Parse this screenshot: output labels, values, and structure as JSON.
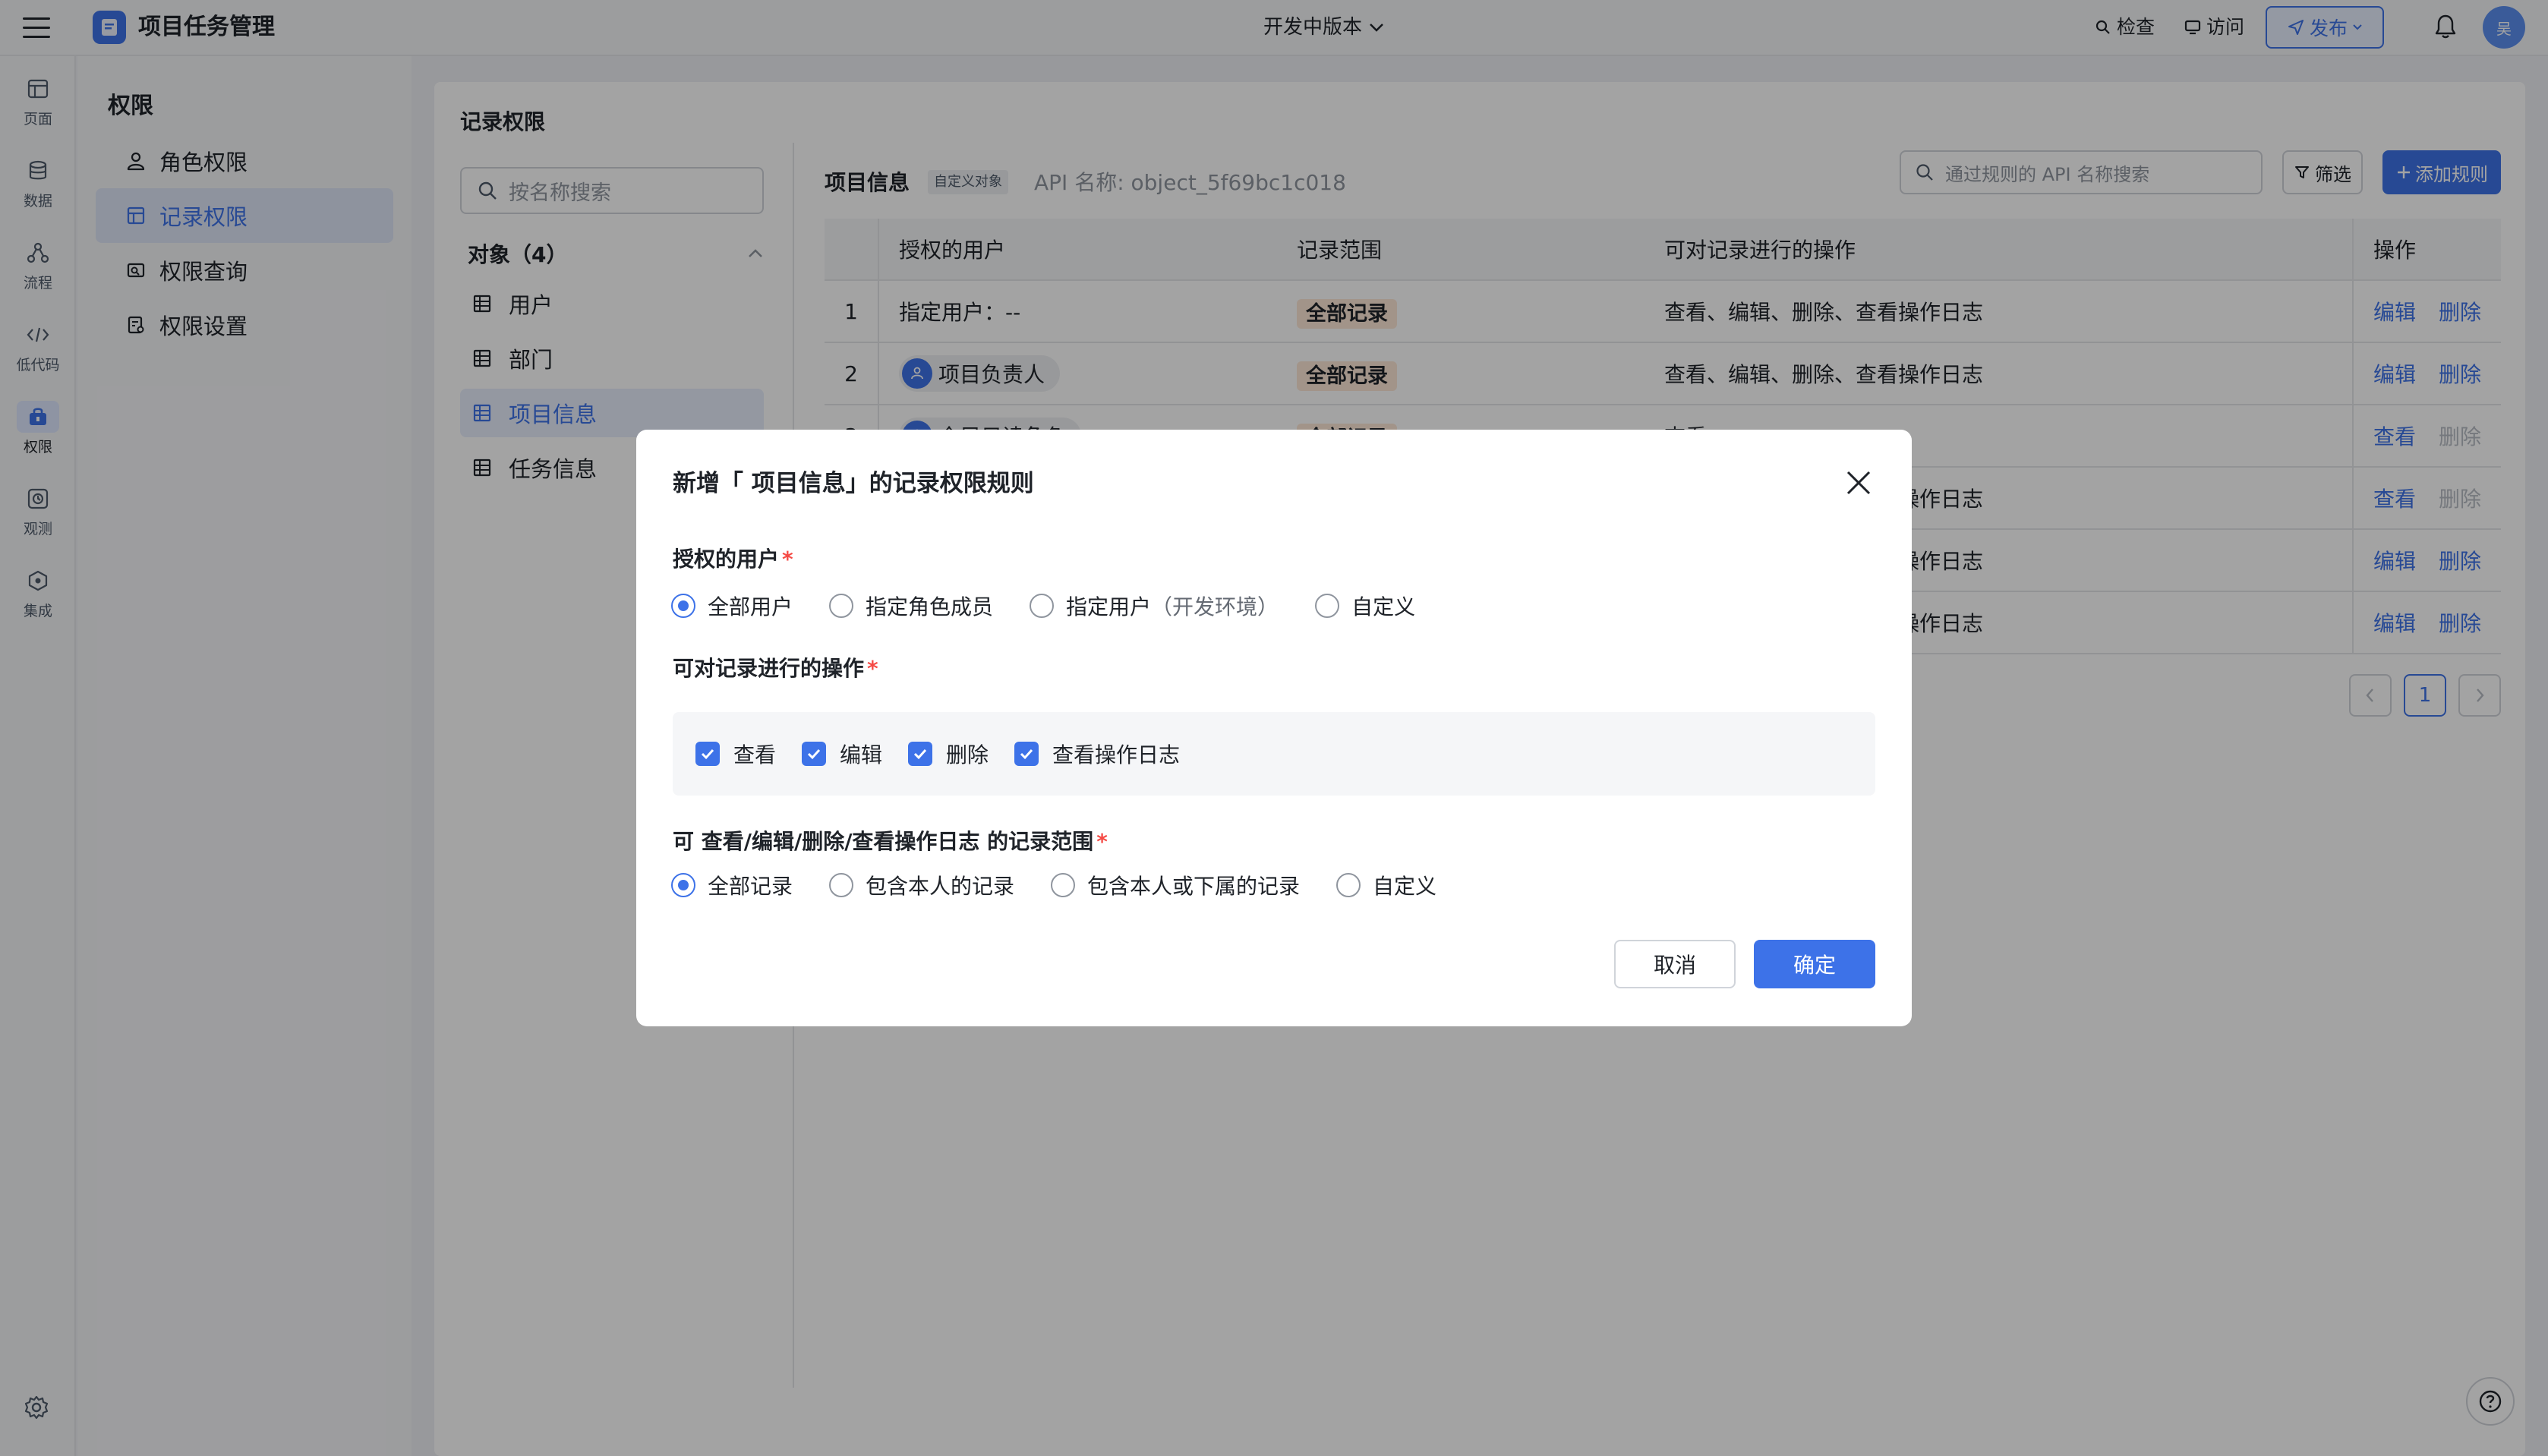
{
  "header": {
    "app_title": "项目任务管理",
    "version": "开发中版本",
    "inspect": "检查",
    "visit": "访问",
    "publish": "发布",
    "avatar": "吴"
  },
  "rail": {
    "items": [
      {
        "label": "页面",
        "icon": "page-icon"
      },
      {
        "label": "数据",
        "icon": "database-icon"
      },
      {
        "label": "流程",
        "icon": "flow-icon"
      },
      {
        "label": "低代码",
        "icon": "code-icon"
      },
      {
        "label": "权限",
        "icon": "permission-icon",
        "active": true
      },
      {
        "label": "观测",
        "icon": "observe-icon"
      },
      {
        "label": "集成",
        "icon": "integration-icon"
      }
    ]
  },
  "sidebar": {
    "title": "权限",
    "items": [
      {
        "label": "角色权限",
        "icon": "user-icon"
      },
      {
        "label": "记录权限",
        "icon": "table-icon",
        "active": true
      },
      {
        "label": "权限查询",
        "icon": "query-icon"
      },
      {
        "label": "权限设置",
        "icon": "settings-doc-icon"
      }
    ]
  },
  "main": {
    "title": "记录权限",
    "obj_search_placeholder": "按名称搜索",
    "obj_group": "对象（4）",
    "objects": [
      "用户",
      "部门",
      "项目信息",
      "任务信息"
    ],
    "table_title": "项目信息",
    "custom_tag": "自定义对象",
    "api_name": "API 名称: object_5f69bc1c018",
    "rule_search_placeholder": "通过规则的 API 名称搜索",
    "filter": "筛选",
    "add_rule": "添加规则",
    "columns": [
      "授权的用户",
      "记录范围",
      "可对记录进行的操作",
      "操作"
    ],
    "rows": [
      {
        "idx": "1",
        "user": "指定用户：--",
        "range": "全部记录",
        "ops": "查看、编辑、删除、查看操作日志",
        "a1": "编辑",
        "a2": "删除",
        "a1_enabled": true,
        "a2_enabled": true
      },
      {
        "idx": "2",
        "user": "项目负责人",
        "range": "全部记录",
        "ops": "查看、编辑、删除、查看操作日志",
        "a1": "编辑",
        "a2": "删除",
        "a1_enabled": true,
        "a2_enabled": true
      },
      {
        "idx": "3",
        "user": "全局只读角色",
        "range": "全部记录",
        "ops": "查看",
        "a1": "查看",
        "a2": "删除",
        "a1_enabled": true,
        "a2_enabled": false
      },
      {
        "idx": "4",
        "user": "",
        "range": "",
        "ops": "查看、编辑、删除、查看操作日志",
        "a1": "查看",
        "a2": "删除",
        "a1_enabled": true,
        "a2_enabled": false
      },
      {
        "idx": "5",
        "user": "",
        "range": "",
        "ops": "查看、编辑、删除、查看操作日志",
        "a1": "编辑",
        "a2": "删除",
        "a1_enabled": true,
        "a2_enabled": true
      },
      {
        "idx": "6",
        "user": "",
        "range": "",
        "ops": "查看、编辑、删除、查看操作日志",
        "a1": "编辑",
        "a2": "删除",
        "a1_enabled": true,
        "a2_enabled": true
      }
    ],
    "page": "1"
  },
  "modal": {
    "title": "新增「 项目信息」的记录权限规则",
    "users_label": "授权的用户",
    "users_options": [
      "全部用户",
      "指定角色成员",
      "指定用户",
      "自定义"
    ],
    "users_option3_suffix": "（开发环境）",
    "users_selected": "全部用户",
    "ops_label": "可对记录进行的操作",
    "ops_options": [
      "查看",
      "编辑",
      "删除",
      "查看操作日志"
    ],
    "ops_checked": [
      true,
      true,
      true,
      true
    ],
    "range_label": "可 查看/编辑/删除/查看操作日志 的记录范围",
    "range_options": [
      "全部记录",
      "包含本人的记录",
      "包含本人或下属的记录",
      "自定义"
    ],
    "range_selected": "全部记录",
    "cancel": "取消",
    "confirm": "确定"
  },
  "colors": {
    "accent": "#3d72e8",
    "required": "#f54a45",
    "range_tag_bg": "#fde8d6"
  }
}
